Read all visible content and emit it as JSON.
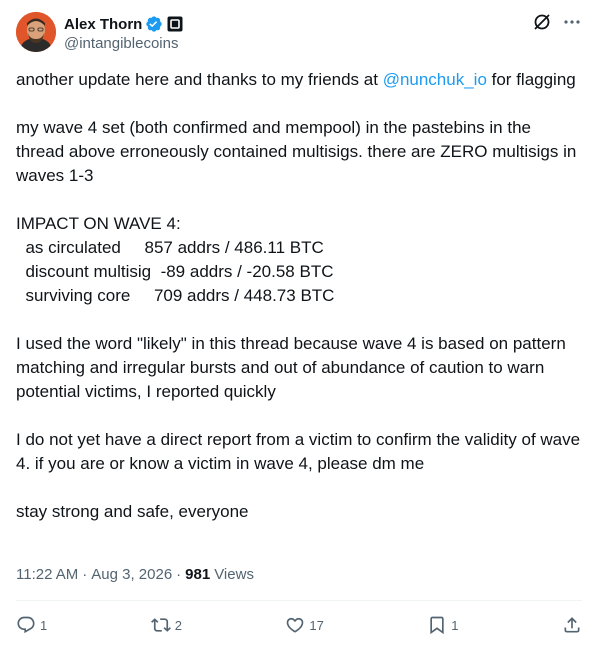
{
  "author": {
    "display_name": "Alex Thorn",
    "handle": "@intangiblecoins"
  },
  "tweet": {
    "line1_before": "another update here and thanks to my friends at ",
    "mention": "@nunchuk_io",
    "line1_after": " for flagging",
    "para2": "my wave 4 set (both confirmed and mempool) in the pastebins in the thread above erroneously contained multisigs. there are ZERO multisigs in waves 1-3",
    "impact_heading": "IMPACT ON WAVE 4:",
    "impact_rows": [
      "  as circulated     857 addrs / 486.11 BTC",
      "  discount multisig  -89 addrs / -20.58 BTC",
      "  surviving core     709 addrs / 448.73 BTC"
    ],
    "para4": "I used the word \"likely\" in this thread because wave 4 is based on pattern matching and irregular bursts and out of abundance of caution to warn potential victims, I reported quickly",
    "para5": "I do not yet have a direct report from a victim to confirm the validity of wave 4. if you are or know a victim in wave 4, please dm me",
    "para6": "stay strong and safe, everyone"
  },
  "meta": {
    "time": "11:22 AM",
    "date": "Aug 3, 2026",
    "separator": "·",
    "views_count": "981",
    "views_label": "Views"
  },
  "actions": {
    "reply_count": "1",
    "repost_count": "2",
    "like_count": "17",
    "bookmark_count": "1"
  },
  "colors": {
    "accent": "#1d9bf0",
    "secondary_text": "#536471",
    "avatar_bg": "#e0562a"
  }
}
